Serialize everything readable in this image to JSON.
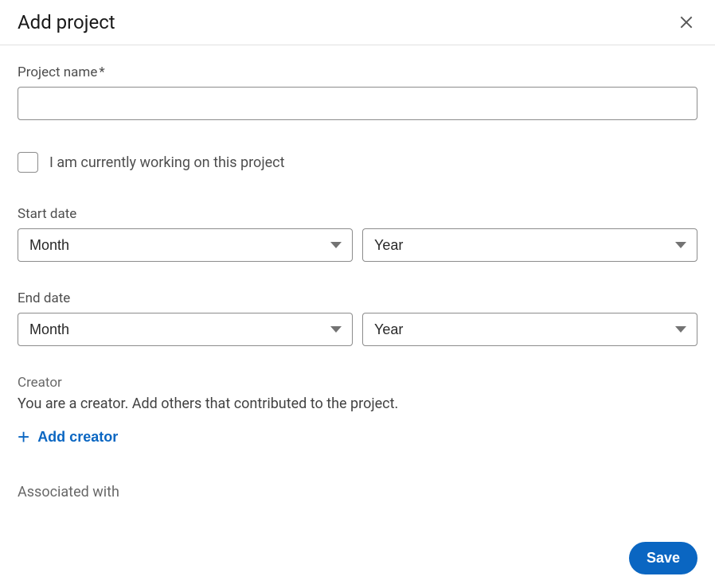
{
  "header": {
    "title": "Add project"
  },
  "form": {
    "project_name_label": "Project name",
    "required_mark": "*",
    "project_name_value": "",
    "checkbox_label": "I am currently working on this project",
    "start_date_label": "Start date",
    "end_date_label": "End date",
    "month_placeholder": "Month",
    "year_placeholder": "Year",
    "creator_label": "Creator",
    "creator_desc": "You are a creator. Add others that contributed to the project.",
    "add_creator_label": "Add creator",
    "associated_label": "Associated with"
  },
  "footer": {
    "save_label": "Save"
  }
}
